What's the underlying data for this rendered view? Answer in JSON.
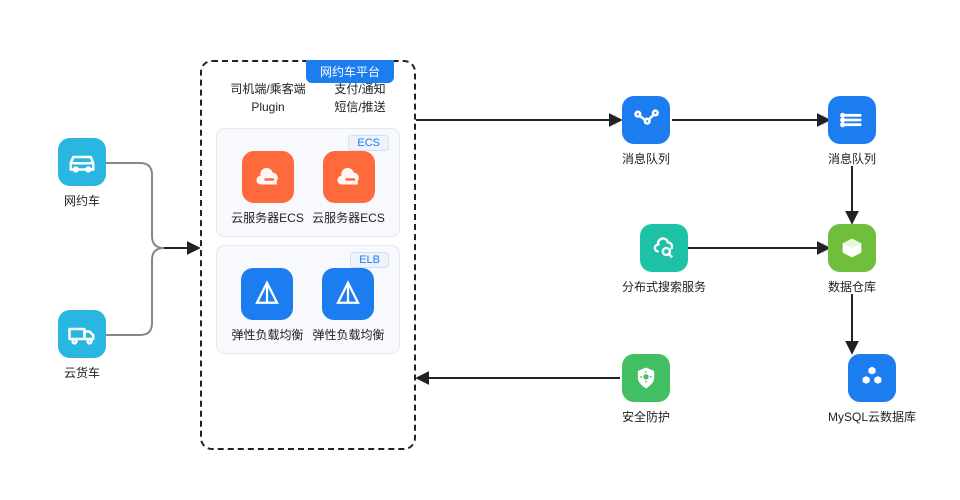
{
  "left": {
    "car": {
      "label": "网约车"
    },
    "truck": {
      "label": "云货车"
    }
  },
  "cluster": {
    "tab": "网约车平台",
    "top": {
      "left": {
        "t1": "司机端/乘客端",
        "t2": "Plugin"
      },
      "right": {
        "t1": "支付/通知",
        "t2": "短信/推送"
      }
    },
    "ecs": {
      "badge": "ECS",
      "a": "云服务器ECS",
      "b": "云服务器ECS"
    },
    "elb": {
      "badge": "ELB",
      "a": "弹性负载均衡",
      "b": "弹性负载均衡"
    }
  },
  "right": {
    "kafka": {
      "label": "消息队列"
    },
    "queue": {
      "label": "消息队列"
    },
    "search": {
      "label": "分布式搜索服务"
    },
    "db": {
      "label": "数据仓库"
    },
    "shield": {
      "label": "安全防护"
    },
    "cluster": {
      "label": "MySQL云数据库"
    }
  }
}
